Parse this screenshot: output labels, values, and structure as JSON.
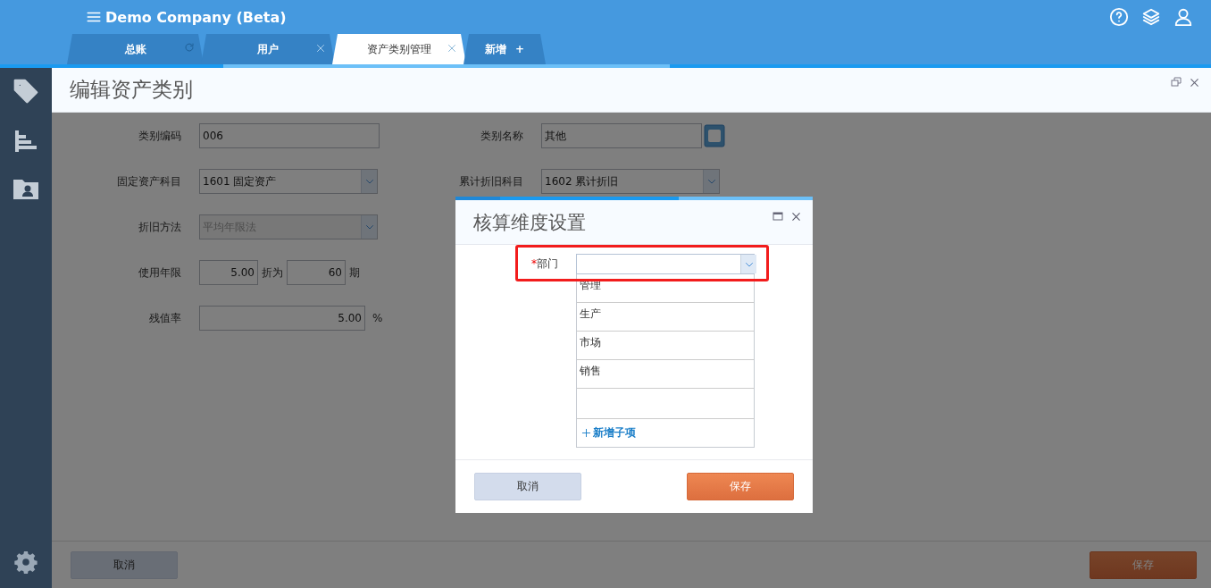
{
  "header": {
    "company": "Demo Company (Beta)"
  },
  "tabs": [
    {
      "label": "总账",
      "selected": false,
      "kind": "refresh"
    },
    {
      "label": "用户",
      "selected": false,
      "kind": "close"
    },
    {
      "label": "资产类别管理",
      "selected": true,
      "kind": "close"
    },
    {
      "label": "新增",
      "selected": false,
      "kind": "add",
      "symbol": "+"
    }
  ],
  "page": {
    "title": "编辑资产类别"
  },
  "form": {
    "rows": [
      {
        "fields": [
          {
            "label": "类别编码",
            "kind": "text",
            "value": "006"
          },
          {
            "label": "类别名称",
            "kind": "lookup",
            "value": "其他"
          }
        ]
      },
      {
        "fields": [
          {
            "label": "固定资产科目",
            "kind": "select",
            "value": "1601 固定资产"
          },
          {
            "label": "累计折旧科目",
            "kind": "select",
            "value": "1602 累计折旧"
          }
        ]
      },
      {
        "fields": [
          {
            "label": "折旧方法",
            "kind": "select",
            "value": "平均年限法",
            "disabled": true
          }
        ]
      },
      {
        "fields": [
          {
            "label": "使用年限",
            "kind": "split",
            "value": "5.00",
            "middle": "折为",
            "value2": "60",
            "unit": "期"
          }
        ]
      },
      {
        "fields": [
          {
            "label": "残值率",
            "kind": "unit",
            "value": "5.00",
            "unit": "%"
          }
        ]
      }
    ]
  },
  "footer": {
    "cancel": "取消",
    "save": "保存"
  },
  "dialog": {
    "title": "核算维度设置",
    "field": {
      "label": "部门",
      "required_mark": "*",
      "highlighted": true
    },
    "options": [
      "管理",
      "生产",
      "市场",
      "销售"
    ],
    "add_item": "新增子项",
    "cancel": "取消",
    "save": "保存"
  }
}
